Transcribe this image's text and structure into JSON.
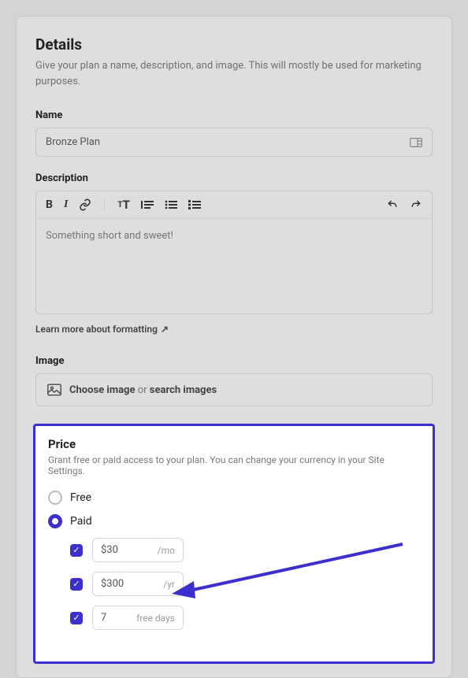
{
  "details": {
    "title": "Details",
    "subtitle": "Give your plan a name, description, and image. This will mostly be used for marketing purposes.",
    "name_label": "Name",
    "name_value": "Bronze Plan",
    "description_label": "Description",
    "description_value": "Something short and sweet!",
    "learn_more": "Learn more about formatting",
    "image_label": "Image",
    "image_choose": "Choose image",
    "image_or": "or",
    "image_search": "search images"
  },
  "price": {
    "title": "Price",
    "subtitle": "Grant free or paid access to your plan. You can change your currency in your Site Settings.",
    "option_free": "Free",
    "option_paid": "Paid",
    "rows": [
      {
        "value": "$30",
        "suffix": "/mo"
      },
      {
        "value": "$300",
        "suffix": "/yr"
      },
      {
        "value": "7",
        "suffix": "free days"
      }
    ]
  }
}
